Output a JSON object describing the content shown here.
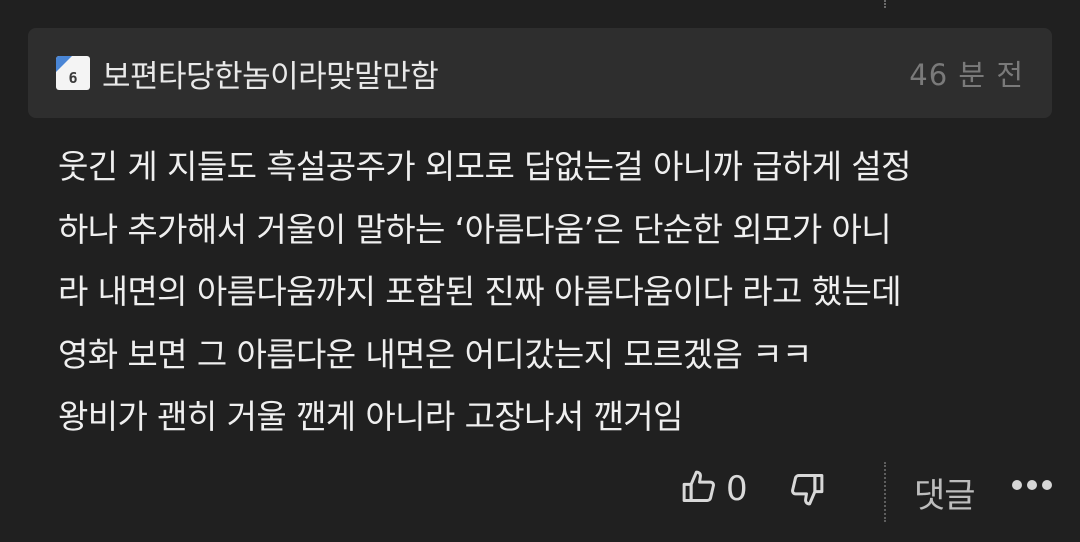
{
  "comment": {
    "level_badge": "6",
    "author": "보편타당한놈이라맞말만함",
    "time": "46 분 전",
    "lines": [
      "웃긴 게 지들도 흑설공주가 외모로 답없는걸 아니까 급하게 설정",
      "하나 추가해서 거울이 말하는 ‘아름다움’은 단순한 외모가 아니",
      "라 내면의 아름다움까지 포함된 진짜 아름다움이다 라고 했는데",
      "영화 보면 그 아름다운 내면은 어디갔는지 모르겠음 ㅋㅋ",
      "왕비가 괜히 거울 깬게 아니라 고장나서 깬거임"
    ]
  },
  "actions": {
    "like_icon": "thumbs-up-icon",
    "like_count": "0",
    "dislike_icon": "thumbs-down-icon",
    "reply_label": "댓글",
    "more_icon": "more-dots-icon"
  },
  "colors": {
    "background": "#202020",
    "header_background": "#2e2e2e",
    "badge_accent": "#4a86d6"
  }
}
